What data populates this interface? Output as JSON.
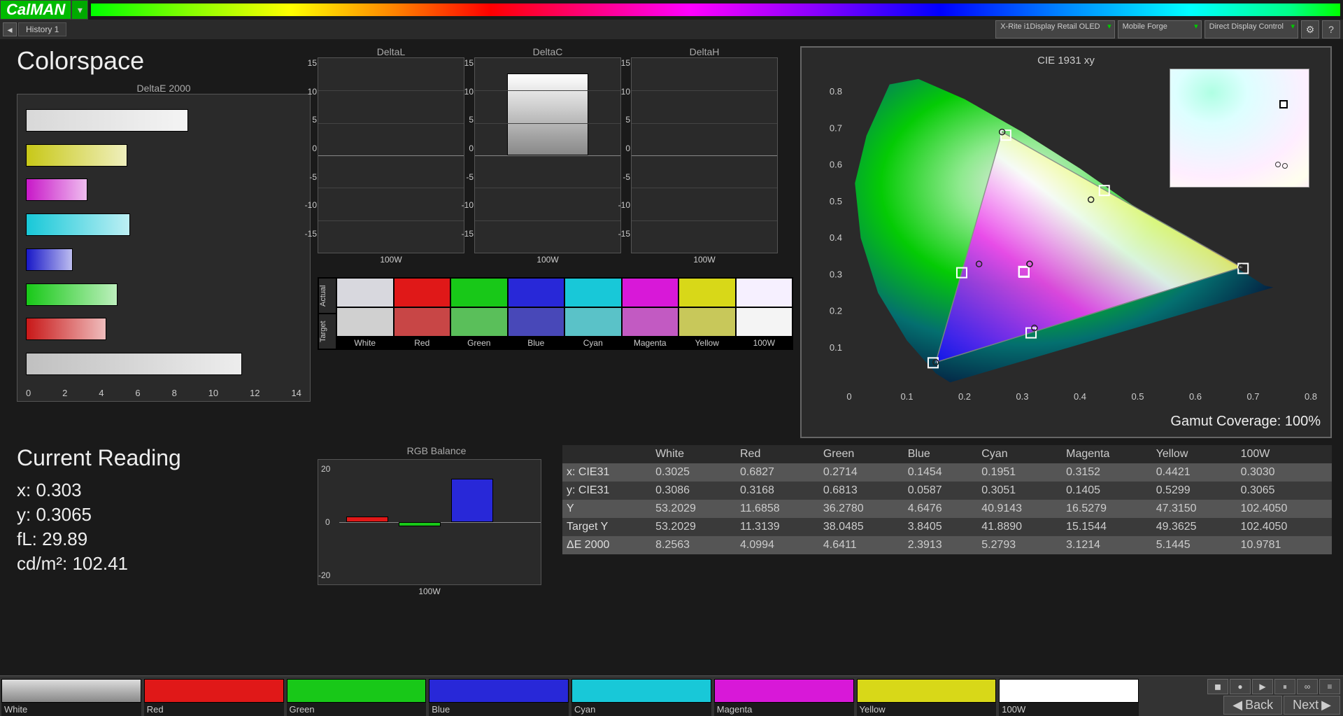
{
  "app": {
    "name": "CalMAN"
  },
  "tabs": {
    "history": "History 1"
  },
  "dropdowns": {
    "meter": "X-Rite i1Display Retail OLED",
    "source": "Mobile Forge",
    "display": "Direct Display Control"
  },
  "page": {
    "title": "Colorspace",
    "deltaE_title": "DeltaE 2000",
    "cie_title": "CIE 1931 xy",
    "gamut_label": "Gamut Coverage:",
    "gamut_value": "100%",
    "rgb_title": "RGB Balance",
    "rgb_xlabel": "100W",
    "current_title": "Current Reading",
    "deltaL_title": "DeltaL",
    "deltaC_title": "DeltaC",
    "deltaH_title": "DeltaH",
    "delta_xlabel": "100W",
    "swatch_actual": "Actual",
    "swatch_target": "Target"
  },
  "nav": {
    "back": "Back",
    "next": "Next"
  },
  "current": {
    "x_label": "x:",
    "x": "0.303",
    "y_label": "y:",
    "y": "0.3065",
    "fl_label": "fL:",
    "fl": "29.89",
    "cd_label": "cd/m²:",
    "cd": "102.41"
  },
  "colors": [
    "White",
    "Red",
    "Green",
    "Blue",
    "Cyan",
    "Magenta",
    "Yellow",
    "100W"
  ],
  "color_hex": {
    "White_a": "#d8d8de",
    "White_t": "#d0d0d0",
    "Red_a": "#e01818",
    "Red_t": "#c84646",
    "Green_a": "#18c818",
    "Green_t": "#5abf5a",
    "Blue_a": "#2828d8",
    "Blue_t": "#4848b8",
    "Cyan_a": "#18c8d8",
    "Cyan_t": "#5ac2c8",
    "Magenta_a": "#d818d8",
    "Magenta_t": "#c25ac2",
    "Yellow_a": "#d8d818",
    "Yellow_t": "#c8c85a",
    "100W_a": "#f6f0ff",
    "100W_t": "#f4f4f4"
  },
  "table": {
    "cols": [
      "",
      "White",
      "Red",
      "Green",
      "Blue",
      "Cyan",
      "Magenta",
      "Yellow",
      "100W"
    ],
    "rows": [
      [
        "x: CIE31",
        "0.3025",
        "0.6827",
        "0.2714",
        "0.1454",
        "0.1951",
        "0.3152",
        "0.4421",
        "0.3030"
      ],
      [
        "y: CIE31",
        "0.3086",
        "0.3168",
        "0.6813",
        "0.0587",
        "0.3051",
        "0.1405",
        "0.5299",
        "0.3065"
      ],
      [
        "Y",
        "53.2029",
        "11.6858",
        "36.2780",
        "4.6476",
        "40.9143",
        "16.5279",
        "47.3150",
        "102.4050"
      ],
      [
        "Target Y",
        "53.2029",
        "11.3139",
        "38.0485",
        "3.8405",
        "41.8890",
        "15.1544",
        "49.3625",
        "102.4050"
      ],
      [
        "ΔE 2000",
        "8.2563",
        "4.0994",
        "4.6411",
        "2.3913",
        "5.2793",
        "3.1214",
        "5.1445",
        "10.9781"
      ]
    ]
  },
  "chart_data": [
    {
      "type": "bar",
      "title": "DeltaE 2000",
      "orientation": "horizontal",
      "categories": [
        "White",
        "Yellow",
        "Magenta",
        "Cyan",
        "Blue",
        "Green",
        "Red",
        "100W"
      ],
      "values": [
        8.26,
        5.14,
        3.12,
        5.28,
        2.39,
        4.64,
        4.1,
        10.98
      ],
      "colors": [
        "#d8d8d8",
        "#c8c818",
        "#c818c8",
        "#18c8d8",
        "#1818c8",
        "#18c818",
        "#c81818",
        "#c0c0c0"
      ],
      "xlim": [
        0,
        14
      ],
      "xticks": [
        0,
        2,
        4,
        6,
        8,
        10,
        12,
        14
      ]
    },
    {
      "type": "bar",
      "title": "DeltaL",
      "categories": [
        "100W"
      ],
      "values": [
        0
      ],
      "ylim": [
        -15,
        15
      ],
      "yticks": [
        -15,
        -10,
        -5,
        0,
        5,
        10,
        15
      ],
      "xlabel": "100W"
    },
    {
      "type": "bar",
      "title": "DeltaC",
      "categories": [
        "100W"
      ],
      "values": [
        12
      ],
      "ylim": [
        -15,
        15
      ],
      "yticks": [
        -15,
        -10,
        -5,
        0,
        5,
        10,
        15
      ],
      "xlabel": "100W",
      "bar_fill": "gradient-bw"
    },
    {
      "type": "bar",
      "title": "DeltaH",
      "categories": [
        "100W"
      ],
      "values": [
        0
      ],
      "ylim": [
        -15,
        15
      ],
      "yticks": [
        -15,
        -10,
        -5,
        0,
        5,
        10,
        15
      ],
      "xlabel": "100W"
    },
    {
      "type": "bar",
      "title": "RGB Balance",
      "categories": [
        "R",
        "G",
        "B"
      ],
      "values": [
        3,
        -2,
        22
      ],
      "colors": [
        "#e01818",
        "#18c818",
        "#2828d8"
      ],
      "ylim": [
        -25,
        25
      ],
      "yticks": [
        -20,
        0,
        20
      ],
      "xlabel": "100W"
    },
    {
      "type": "scatter",
      "title": "CIE 1931 xy",
      "xlim": [
        0,
        0.8
      ],
      "ylim": [
        0,
        0.85
      ],
      "xticks": [
        0,
        0.1,
        0.2,
        0.3,
        0.4,
        0.5,
        0.6,
        0.7,
        0.8
      ],
      "yticks": [
        0.1,
        0.2,
        0.3,
        0.4,
        0.5,
        0.6,
        0.7,
        0.8
      ],
      "series": [
        {
          "name": "measured",
          "marker": "square",
          "points": [
            [
              0.3025,
              0.3086
            ],
            [
              0.6827,
              0.3168
            ],
            [
              0.2714,
              0.6813
            ],
            [
              0.1454,
              0.0587
            ],
            [
              0.1951,
              0.3051
            ],
            [
              0.3152,
              0.1405
            ],
            [
              0.4421,
              0.5299
            ],
            [
              0.303,
              0.3065
            ]
          ]
        },
        {
          "name": "target",
          "marker": "circle",
          "points": [
            [
              0.3127,
              0.329
            ],
            [
              0.68,
              0.32
            ],
            [
              0.265,
              0.69
            ],
            [
              0.15,
              0.06
            ],
            [
              0.225,
              0.329
            ],
            [
              0.321,
              0.154
            ],
            [
              0.419,
              0.505
            ],
            [
              0.3127,
              0.329
            ]
          ]
        }
      ],
      "triangle": [
        [
          0.68,
          0.32
        ],
        [
          0.265,
          0.69
        ],
        [
          0.15,
          0.06
        ]
      ],
      "annotation": "Gamut Coverage: 100%"
    }
  ]
}
